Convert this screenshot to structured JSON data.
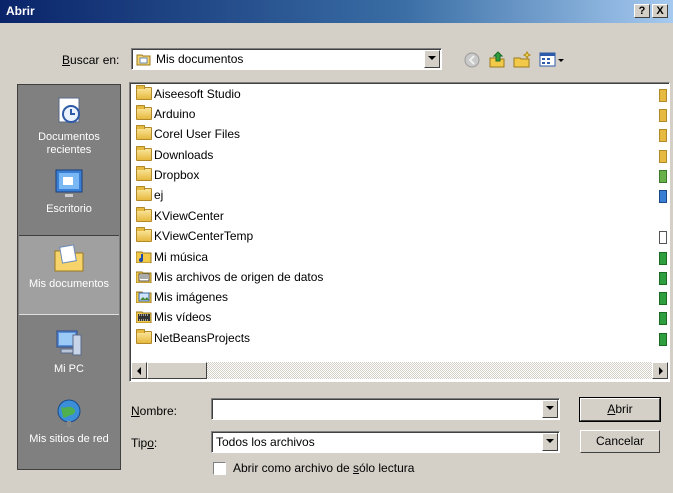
{
  "window": {
    "title": "Abrir",
    "help_button": "?",
    "close_button": "X"
  },
  "look_in": {
    "label_prefix": "",
    "label_accel": "B",
    "label_rest": "uscar en:",
    "value": "Mis documentos"
  },
  "places": [
    {
      "label": "Documentos recientes",
      "icon": "recent-documents-icon"
    },
    {
      "label": "Escritorio",
      "icon": "desktop-icon"
    },
    {
      "label": "Mis documentos",
      "icon": "my-documents-icon"
    },
    {
      "label": "Mi PC",
      "icon": "my-computer-icon"
    },
    {
      "label": "Mis sitios de red",
      "icon": "network-places-icon"
    }
  ],
  "files": [
    {
      "name": "Aiseesoft Studio",
      "icon": "folder-icon"
    },
    {
      "name": "Arduino",
      "icon": "folder-icon"
    },
    {
      "name": "Corel User Files",
      "icon": "folder-icon"
    },
    {
      "name": "Downloads",
      "icon": "folder-icon"
    },
    {
      "name": "Dropbox",
      "icon": "folder-icon"
    },
    {
      "name": "ej",
      "icon": "folder-icon"
    },
    {
      "name": "KViewCenter",
      "icon": "folder-icon"
    },
    {
      "name": "KViewCenterTemp",
      "icon": "folder-icon"
    },
    {
      "name": "Mi música",
      "icon": "music-folder-icon"
    },
    {
      "name": "Mis archivos de origen de datos",
      "icon": "data-sources-folder-icon"
    },
    {
      "name": "Mis imágenes",
      "icon": "pictures-folder-icon"
    },
    {
      "name": "Mis vídeos",
      "icon": "videos-folder-icon"
    },
    {
      "name": "NetBeansProjects",
      "icon": "folder-icon"
    }
  ],
  "filename": {
    "label_accel": "N",
    "label_rest": "ombre:",
    "value": ""
  },
  "filetype": {
    "label_pre": "Tip",
    "label_accel": "o",
    "label_post": ":",
    "value": "Todos los archivos"
  },
  "readonly": {
    "label_pre": "Abrir como archivo de ",
    "label_accel": "s",
    "label_post": "ólo lectura",
    "checked": false
  },
  "buttons": {
    "open_accel": "A",
    "open_rest": "brir",
    "cancel": "Cancelar"
  },
  "colors": {
    "title_bar": "#0a246a",
    "dialog_bg": "#d4d0c8",
    "places_bg": "#808080"
  }
}
